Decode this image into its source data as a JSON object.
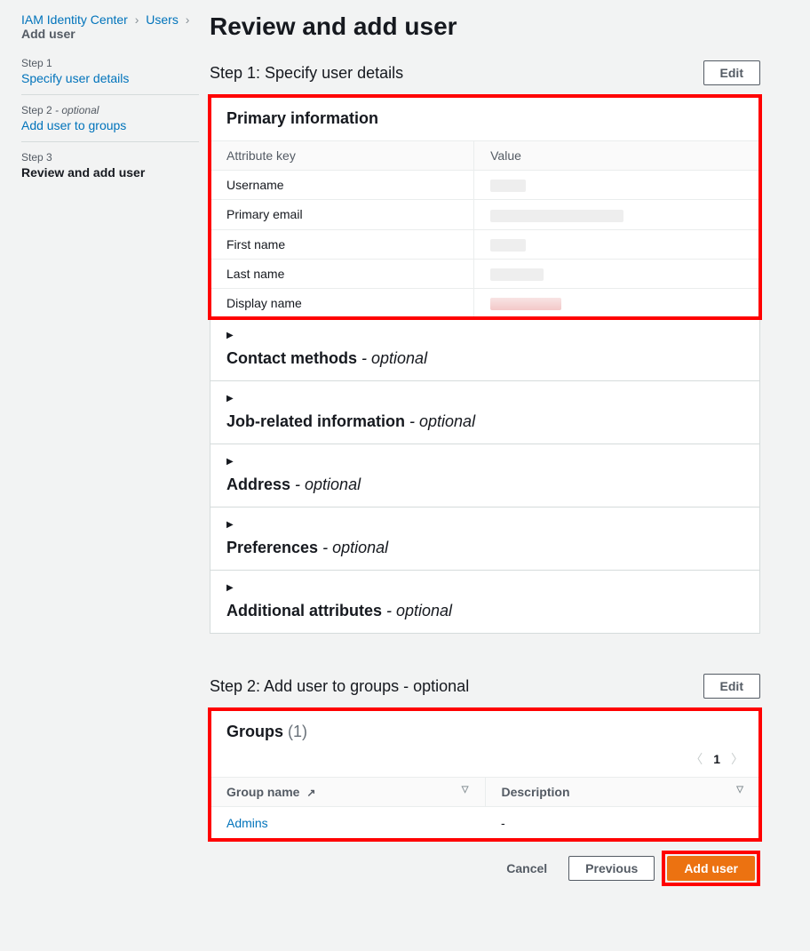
{
  "breadcrumb": {
    "items": [
      "IAM Identity Center",
      "Users",
      "Add user"
    ]
  },
  "nav": {
    "steps": [
      {
        "no": "Step 1",
        "optional": "",
        "title": "Specify user details",
        "link": true
      },
      {
        "no": "Step 2",
        "optional": " - optional",
        "title": "Add user to groups",
        "link": true
      },
      {
        "no": "Step 3",
        "optional": "",
        "title": "Review and add user",
        "link": false
      }
    ]
  },
  "heading": "Review and add user",
  "step1": {
    "label": "Step 1: Specify user details",
    "edit": "Edit",
    "primary": {
      "title": "Primary information",
      "headers": {
        "key": "Attribute key",
        "value": "Value"
      },
      "rows": [
        {
          "key": "Username"
        },
        {
          "key": "Primary email"
        },
        {
          "key": "First name"
        },
        {
          "key": "Last name"
        },
        {
          "key": "Display name"
        }
      ]
    },
    "expanders": [
      {
        "title": "Contact methods",
        "optional": " - optional"
      },
      {
        "title": "Job-related information",
        "optional": " - optional"
      },
      {
        "title": "Address",
        "optional": " - optional"
      },
      {
        "title": "Preferences",
        "optional": " - optional"
      },
      {
        "title": "Additional attributes",
        "optional": " - optional"
      }
    ]
  },
  "step2": {
    "label": "Step 2: Add user to groups - optional",
    "edit": "Edit",
    "groups": {
      "title": "Groups",
      "count": "(1)",
      "page": "1",
      "headers": {
        "name": "Group name",
        "desc": "Description"
      },
      "rows": [
        {
          "name": "Admins",
          "desc": "-"
        }
      ]
    }
  },
  "footer": {
    "cancel": "Cancel",
    "previous": "Previous",
    "add": "Add user"
  }
}
